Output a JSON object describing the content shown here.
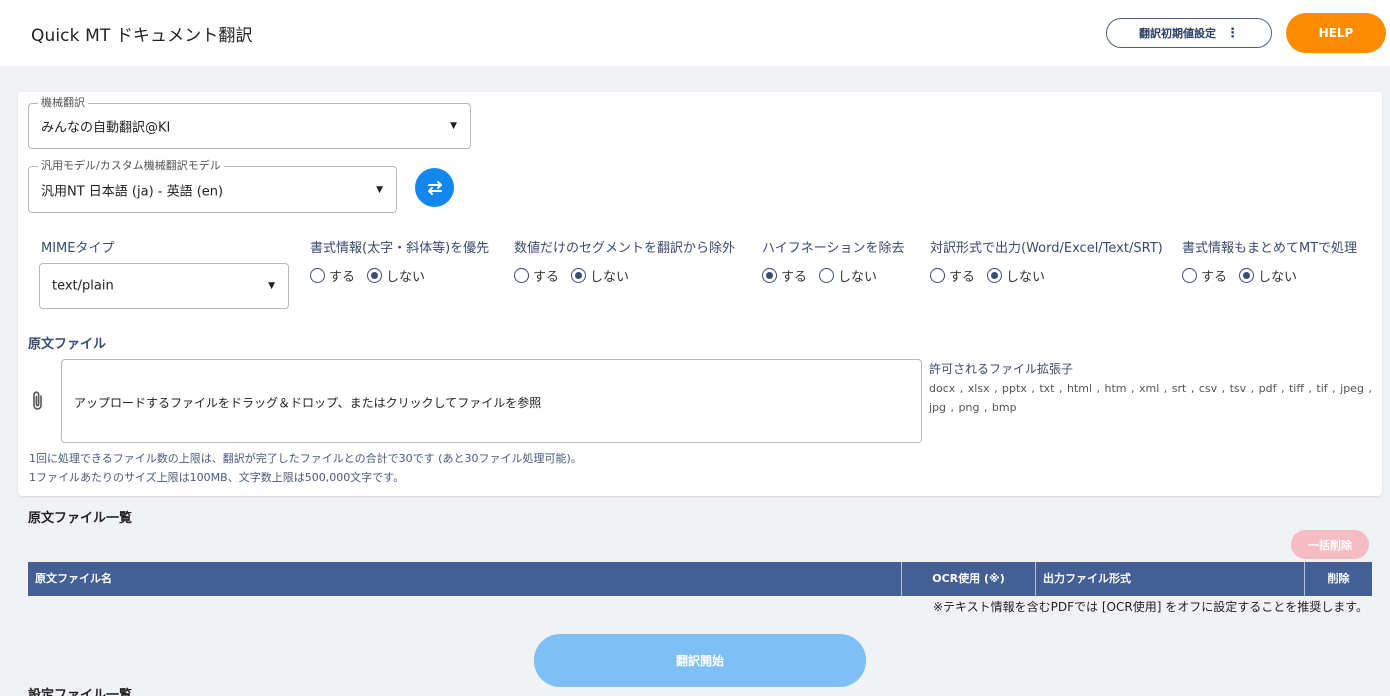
{
  "header": {
    "title": "Quick MT ドキュメント翻訳",
    "settings_label": "翻訳初期値設定",
    "help_label": "HELP"
  },
  "engine": {
    "legend": "機械翻訳",
    "value": "みんなの自動翻訳@KI"
  },
  "model": {
    "legend": "汎用モデル/カスタム機械翻訳モデル",
    "value": "汎用NT 日本語 (ja) - 英語 (en)"
  },
  "mime": {
    "label": "MIMEタイプ",
    "value": "text/plain"
  },
  "options": [
    {
      "label": "書式情報(太字・斜体等)を優先",
      "yes": "する",
      "no": "しない",
      "selected": "no"
    },
    {
      "label": "数値だけのセグメントを翻訳から除外",
      "yes": "する",
      "no": "しない",
      "selected": "no"
    },
    {
      "label": "ハイフネーションを除去",
      "yes": "する",
      "no": "しない",
      "selected": "yes"
    },
    {
      "label": "対訳形式で出力(Word/Excel/Text/SRT)",
      "yes": "する",
      "no": "しない",
      "selected": "no"
    },
    {
      "label": "書式情報もまとめてMTで処理",
      "yes": "する",
      "no": "しない",
      "selected": "no"
    }
  ],
  "source": {
    "title": "原文ファイル",
    "dropzone_text": "アップロードするファイルをドラッグ＆ドロップ、またはクリックしてファイルを参照",
    "ext_title": "許可されるファイル拡張子",
    "ext_list": "docx , xlsx , pptx , txt , html , htm , xml , srt , csv , tsv , pdf , tiff , tif , jpeg , jpg , png , bmp",
    "note1": "1回に処理できるファイル数の上限は、翻訳が完了したファイルとの合計で30です (あと30ファイル処理可能)。",
    "note2": "1ファイルあたりのサイズ上限は100MB、文字数上限は500,000文字です。"
  },
  "file_list": {
    "title": "原文ファイル一覧",
    "bulk_delete": "一括削除",
    "columns": [
      "原文ファイル名",
      "OCR使用 (※)",
      "出力ファイル形式",
      "削除"
    ],
    "note": "※テキスト情報を含むPDFでは [OCR使用] をオフに設定することを推奨します。"
  },
  "actions": {
    "start": "翻訳開始"
  },
  "next_section_title": "設定ファイル一覧"
}
